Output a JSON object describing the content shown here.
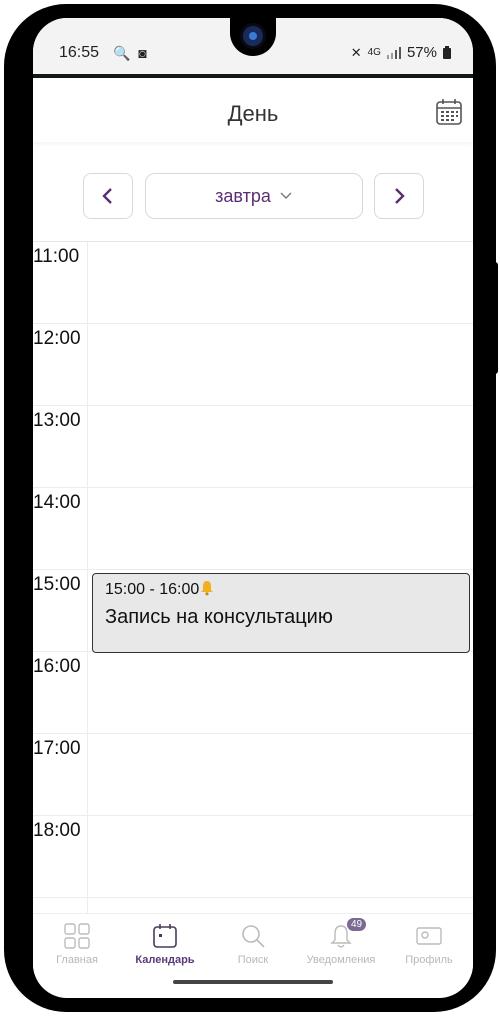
{
  "status_bar": {
    "time": "16:55",
    "left_icons": "🔍 ◙",
    "signal_text": "4G",
    "battery": "57%"
  },
  "header": {
    "title": "День",
    "calendar_icon": "calendar-grid-icon"
  },
  "date_nav": {
    "prev_icon": "chevron-left-icon",
    "selected": "завтра",
    "next_icon": "chevron-right-icon"
  },
  "timeline": {
    "hours": [
      "11:00",
      "12:00",
      "13:00",
      "14:00",
      "15:00",
      "16:00",
      "17:00",
      "18:00"
    ]
  },
  "event": {
    "time": "15:00 - 16:00",
    "title": "Запись на консультацию"
  },
  "tabbar": {
    "items": [
      {
        "label": "Главная",
        "icon": "grid-icon",
        "active": false
      },
      {
        "label": "Календарь",
        "icon": "calendar-icon",
        "active": true
      },
      {
        "label": "Поиск",
        "icon": "search-icon",
        "active": false
      },
      {
        "label": "Уведомления",
        "icon": "bell-icon",
        "active": false,
        "badge": "49"
      },
      {
        "label": "Профиль",
        "icon": "profile-icon",
        "active": false
      }
    ]
  },
  "colors": {
    "accent": "#5b2e74",
    "event_bg": "#e8e8e8"
  }
}
